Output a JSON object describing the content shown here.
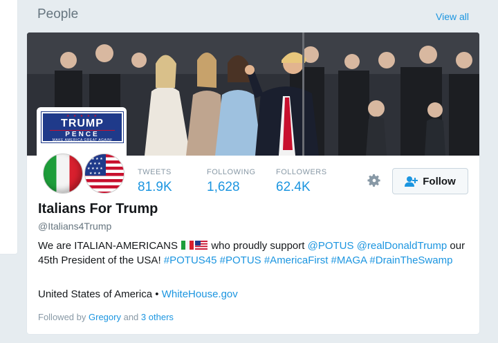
{
  "module": {
    "title": "People",
    "view_all": "View all"
  },
  "profile": {
    "name": "Italians For Trump",
    "handle": "@Italians4Trump",
    "avatar_sign": {
      "line1": "TRUMP",
      "line2": "PENCE",
      "line3": "MAKE AMERICA GREAT AGAIN!"
    },
    "stats": [
      {
        "label": "TWEETS",
        "value": "81.9K"
      },
      {
        "label": "FOLLOWING",
        "value": "1,628"
      },
      {
        "label": "FOLLOWERS",
        "value": "62.4K"
      }
    ],
    "follow_label": "Follow",
    "bio": {
      "prefix": "We are ITALIAN-AMERICANS",
      "middle": "who proudly support",
      "mention1": "@POTUS",
      "mention2": "@realDonaldTrump",
      "text2": "our 45th President of the USA!",
      "hashtags": [
        "#POTUS45",
        "#POTUS",
        "#AmericaFirst",
        "#MAGA",
        "#DrainTheSwamp"
      ]
    },
    "location": "United States of America",
    "separator": "•",
    "website": "WhiteHouse.gov",
    "followed_by": {
      "prefix": "Followed by",
      "user": "Gregory",
      "conj": "and",
      "others": "3 others"
    }
  },
  "colors": {
    "link": "#1b95e0",
    "muted": "#8899a6",
    "background": "#e6ecf0"
  }
}
